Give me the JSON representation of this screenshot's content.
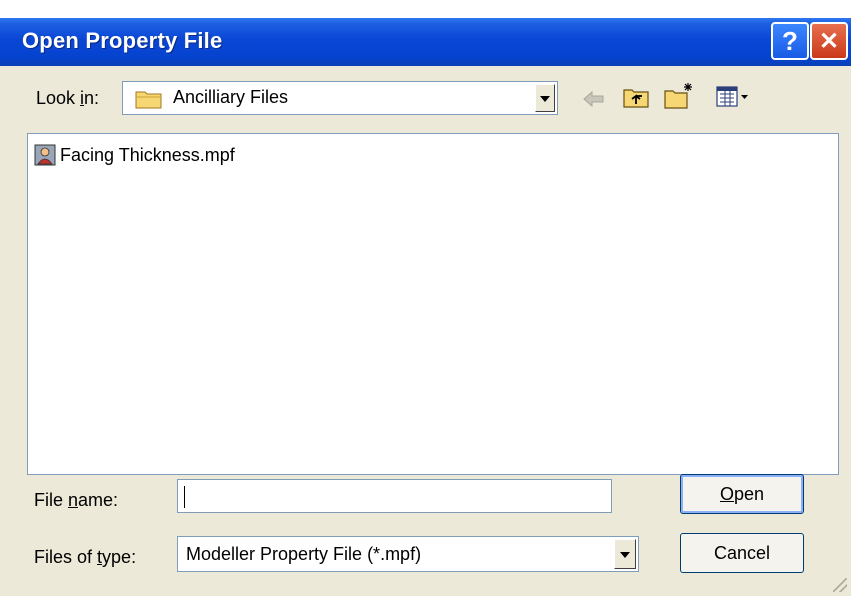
{
  "window": {
    "title": "Open Property File",
    "help_glyph": "?",
    "close_glyph": "✕"
  },
  "lookin": {
    "label_pre": "Look ",
    "label_accel": "i",
    "label_post": "n:",
    "value": "Ancilliary Files"
  },
  "files": [
    {
      "name": "Facing Thickness.mpf",
      "icon": "property-file-icon"
    }
  ],
  "filename": {
    "label_pre": "File ",
    "label_accel": "n",
    "label_post": "ame:",
    "value": ""
  },
  "filetype": {
    "label_pre": "Files of ",
    "label_accel": "t",
    "label_post": "ype:",
    "value": "Modeller Property File (*.mpf)"
  },
  "buttons": {
    "open_accel": "O",
    "open_rest": "pen",
    "cancel": "Cancel"
  },
  "colors": {
    "titlebar": "#0a46d6",
    "dialog_bg": "#ece9d8",
    "close_button": "#c9391a"
  }
}
